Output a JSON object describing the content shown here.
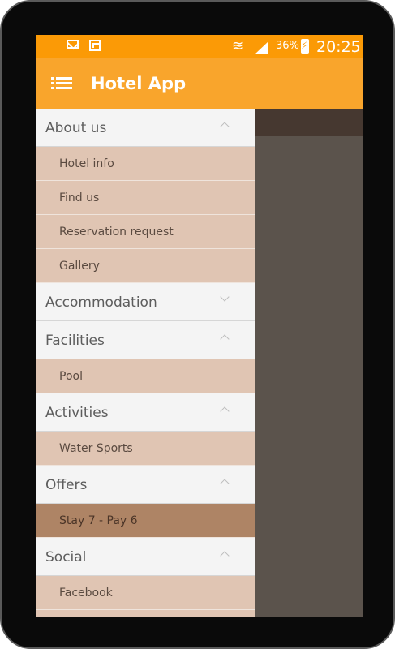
{
  "status_bar": {
    "battery_percent": "36%",
    "time": "20:25"
  },
  "app_bar": {
    "title": "Hotel App"
  },
  "drawer": {
    "about_us": {
      "label": "About us",
      "items": [
        "Hotel info",
        "Find us",
        "Reservation request",
        "Gallery"
      ]
    },
    "accommodation": {
      "label": "Accommodation"
    },
    "facilities": {
      "label": "Facilities",
      "items": [
        "Pool"
      ]
    },
    "activities": {
      "label": "Activities",
      "items": [
        "Water Sports"
      ]
    },
    "offers": {
      "label": "Offers",
      "items": [
        "Stay 7 - Pay 6"
      ]
    },
    "social": {
      "label": "Social",
      "items": [
        "Facebook"
      ]
    }
  },
  "colors": {
    "status_bar": "#fb9a06",
    "app_bar": "#f9a52c",
    "sub_item": "#e0c5b3",
    "sub_item_selected": "#ae8465",
    "header_item": "#f4f4f4",
    "scrim": "#5b534c"
  }
}
